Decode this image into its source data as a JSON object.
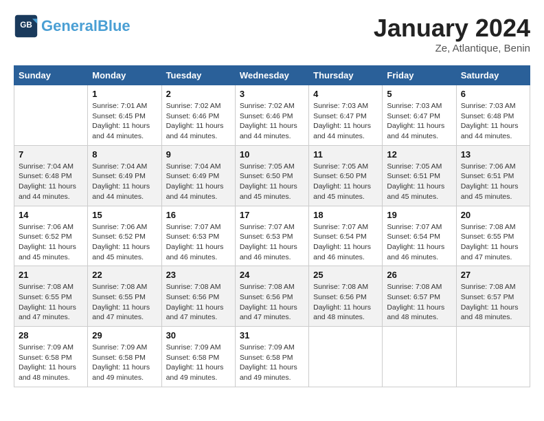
{
  "header": {
    "logo_line1": "General",
    "logo_line2": "Blue",
    "title": "January 2024",
    "subtitle": "Ze, Atlantique, Benin"
  },
  "columns": [
    "Sunday",
    "Monday",
    "Tuesday",
    "Wednesday",
    "Thursday",
    "Friday",
    "Saturday"
  ],
  "weeks": [
    [
      {
        "day": "",
        "info": ""
      },
      {
        "day": "1",
        "info": "Sunrise: 7:01 AM\nSunset: 6:45 PM\nDaylight: 11 hours and 44 minutes."
      },
      {
        "day": "2",
        "info": "Sunrise: 7:02 AM\nSunset: 6:46 PM\nDaylight: 11 hours and 44 minutes."
      },
      {
        "day": "3",
        "info": "Sunrise: 7:02 AM\nSunset: 6:46 PM\nDaylight: 11 hours and 44 minutes."
      },
      {
        "day": "4",
        "info": "Sunrise: 7:03 AM\nSunset: 6:47 PM\nDaylight: 11 hours and 44 minutes."
      },
      {
        "day": "5",
        "info": "Sunrise: 7:03 AM\nSunset: 6:47 PM\nDaylight: 11 hours and 44 minutes."
      },
      {
        "day": "6",
        "info": "Sunrise: 7:03 AM\nSunset: 6:48 PM\nDaylight: 11 hours and 44 minutes."
      }
    ],
    [
      {
        "day": "7",
        "info": "Sunrise: 7:04 AM\nSunset: 6:48 PM\nDaylight: 11 hours and 44 minutes."
      },
      {
        "day": "8",
        "info": "Sunrise: 7:04 AM\nSunset: 6:49 PM\nDaylight: 11 hours and 44 minutes."
      },
      {
        "day": "9",
        "info": "Sunrise: 7:04 AM\nSunset: 6:49 PM\nDaylight: 11 hours and 44 minutes."
      },
      {
        "day": "10",
        "info": "Sunrise: 7:05 AM\nSunset: 6:50 PM\nDaylight: 11 hours and 45 minutes."
      },
      {
        "day": "11",
        "info": "Sunrise: 7:05 AM\nSunset: 6:50 PM\nDaylight: 11 hours and 45 minutes."
      },
      {
        "day": "12",
        "info": "Sunrise: 7:05 AM\nSunset: 6:51 PM\nDaylight: 11 hours and 45 minutes."
      },
      {
        "day": "13",
        "info": "Sunrise: 7:06 AM\nSunset: 6:51 PM\nDaylight: 11 hours and 45 minutes."
      }
    ],
    [
      {
        "day": "14",
        "info": "Sunrise: 7:06 AM\nSunset: 6:52 PM\nDaylight: 11 hours and 45 minutes."
      },
      {
        "day": "15",
        "info": "Sunrise: 7:06 AM\nSunset: 6:52 PM\nDaylight: 11 hours and 45 minutes."
      },
      {
        "day": "16",
        "info": "Sunrise: 7:07 AM\nSunset: 6:53 PM\nDaylight: 11 hours and 46 minutes."
      },
      {
        "day": "17",
        "info": "Sunrise: 7:07 AM\nSunset: 6:53 PM\nDaylight: 11 hours and 46 minutes."
      },
      {
        "day": "18",
        "info": "Sunrise: 7:07 AM\nSunset: 6:54 PM\nDaylight: 11 hours and 46 minutes."
      },
      {
        "day": "19",
        "info": "Sunrise: 7:07 AM\nSunset: 6:54 PM\nDaylight: 11 hours and 46 minutes."
      },
      {
        "day": "20",
        "info": "Sunrise: 7:08 AM\nSunset: 6:55 PM\nDaylight: 11 hours and 47 minutes."
      }
    ],
    [
      {
        "day": "21",
        "info": "Sunrise: 7:08 AM\nSunset: 6:55 PM\nDaylight: 11 hours and 47 minutes."
      },
      {
        "day": "22",
        "info": "Sunrise: 7:08 AM\nSunset: 6:55 PM\nDaylight: 11 hours and 47 minutes."
      },
      {
        "day": "23",
        "info": "Sunrise: 7:08 AM\nSunset: 6:56 PM\nDaylight: 11 hours and 47 minutes."
      },
      {
        "day": "24",
        "info": "Sunrise: 7:08 AM\nSunset: 6:56 PM\nDaylight: 11 hours and 47 minutes."
      },
      {
        "day": "25",
        "info": "Sunrise: 7:08 AM\nSunset: 6:56 PM\nDaylight: 11 hours and 48 minutes."
      },
      {
        "day": "26",
        "info": "Sunrise: 7:08 AM\nSunset: 6:57 PM\nDaylight: 11 hours and 48 minutes."
      },
      {
        "day": "27",
        "info": "Sunrise: 7:08 AM\nSunset: 6:57 PM\nDaylight: 11 hours and 48 minutes."
      }
    ],
    [
      {
        "day": "28",
        "info": "Sunrise: 7:09 AM\nSunset: 6:58 PM\nDaylight: 11 hours and 48 minutes."
      },
      {
        "day": "29",
        "info": "Sunrise: 7:09 AM\nSunset: 6:58 PM\nDaylight: 11 hours and 49 minutes."
      },
      {
        "day": "30",
        "info": "Sunrise: 7:09 AM\nSunset: 6:58 PM\nDaylight: 11 hours and 49 minutes."
      },
      {
        "day": "31",
        "info": "Sunrise: 7:09 AM\nSunset: 6:58 PM\nDaylight: 11 hours and 49 minutes."
      },
      {
        "day": "",
        "info": ""
      },
      {
        "day": "",
        "info": ""
      },
      {
        "day": "",
        "info": ""
      }
    ]
  ]
}
